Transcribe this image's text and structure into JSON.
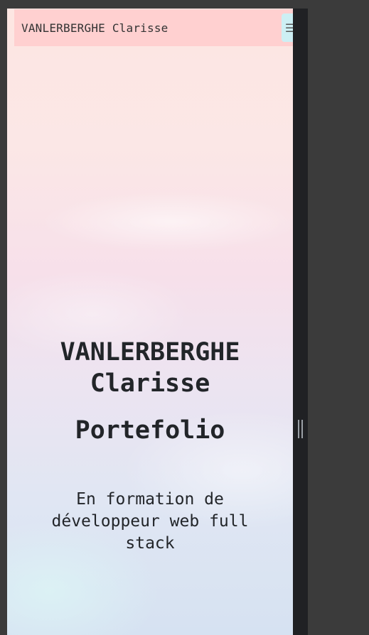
{
  "navbar": {
    "brand": "VANLERBERGHE Clarisse",
    "menu_icon": "hamburger-menu-icon"
  },
  "hero": {
    "name_line1": "VANLERBERGHE",
    "name_line2": "Clarisse",
    "title": "Portefolio",
    "subtitle_line1": "En formation de",
    "subtitle_line2": "développeur web full",
    "subtitle_line3": "stack"
  },
  "devtools": {
    "resize_handle_icon": "drag-handle-icon"
  },
  "colors": {
    "navbar_bg": "#ffd0d0",
    "toggle_bg": "#cdeff4",
    "text": "#222529",
    "devtools_dark": "#202124",
    "frame": "#3b3b3b"
  }
}
